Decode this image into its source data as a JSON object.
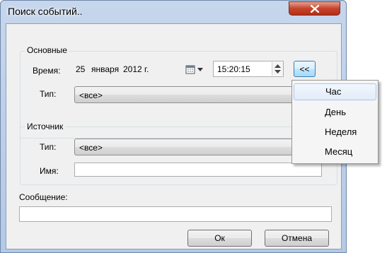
{
  "window": {
    "title": "Поиск событий.."
  },
  "main_group": {
    "title": "Основные",
    "time_label": "Время:",
    "date_day": "25",
    "date_month": "января",
    "date_year": "2012 г.",
    "time_value": "15:20:15",
    "collapse_button": "<<",
    "type_label": "Тип:",
    "type_value": "<все>"
  },
  "source_group": {
    "title": "Источник",
    "type_label": "Тип:",
    "type_value": "<все>",
    "name_label": "Имя:",
    "name_value": ""
  },
  "message": {
    "label": "Сообщение:",
    "value": ""
  },
  "buttons": {
    "ok": "Ок",
    "cancel": "Отмена"
  },
  "menu": {
    "items": [
      "Час",
      "День",
      "Неделя",
      "Месяц"
    ],
    "selected": "Час"
  }
}
